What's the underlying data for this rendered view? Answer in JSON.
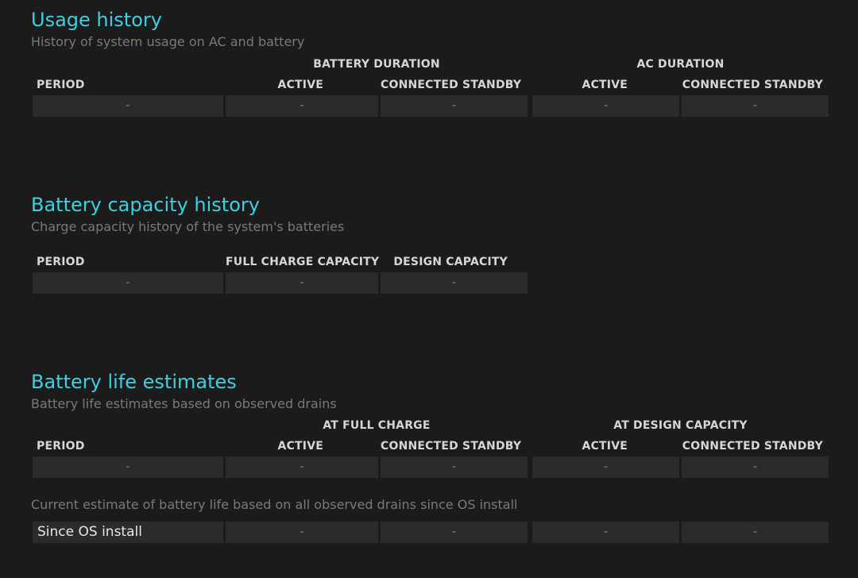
{
  "usage_history": {
    "title": "Usage history",
    "subtitle": "History of system usage on AC and battery",
    "group_battery": "BATTERY DURATION",
    "group_ac": "AC DURATION",
    "col_period": "PERIOD",
    "col_active_1": "ACTIVE",
    "col_standby_1": "CONNECTED STANDBY",
    "col_active_2": "ACTIVE",
    "col_standby_2": "CONNECTED STANDBY",
    "row": [
      "-",
      "-",
      "-",
      "-",
      "-"
    ]
  },
  "battery_capacity_history": {
    "title": "Battery capacity history",
    "subtitle": "Charge capacity history of the system's batteries",
    "col_period": "PERIOD",
    "col_full": "FULL CHARGE CAPACITY",
    "col_design": "DESIGN CAPACITY",
    "row": [
      "-",
      "-",
      "-"
    ]
  },
  "battery_life_estimates": {
    "title": "Battery life estimates",
    "subtitle": "Battery life estimates based on observed drains",
    "group_full": "AT FULL CHARGE",
    "group_design": "AT DESIGN CAPACITY",
    "col_period": "PERIOD",
    "col_active_1": "ACTIVE",
    "col_standby_1": "CONNECTED STANDBY",
    "col_active_2": "ACTIVE",
    "col_standby_2": "CONNECTED STANDBY",
    "row": [
      "-",
      "-",
      "-",
      "-",
      "-"
    ],
    "current_note": "Current estimate of battery life based on all observed drains since OS install",
    "since_row_label": "Since OS install",
    "since_row": [
      "-",
      "-",
      "-",
      "-"
    ]
  }
}
